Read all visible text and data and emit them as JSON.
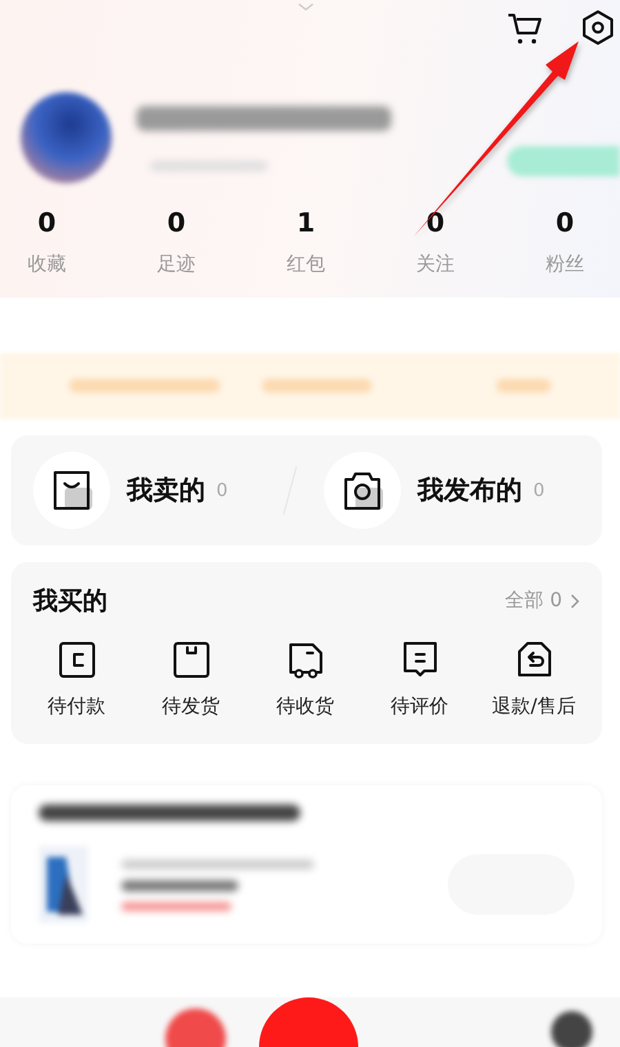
{
  "stats": [
    {
      "value": "0",
      "label": "收藏"
    },
    {
      "value": "0",
      "label": "足迹"
    },
    {
      "value": "1",
      "label": "红包"
    },
    {
      "value": "0",
      "label": "关注"
    },
    {
      "value": "0",
      "label": "粉丝"
    }
  ],
  "selling": [
    {
      "kind": "bag",
      "label": "我卖的",
      "count": "0"
    },
    {
      "kind": "camera",
      "label": "我发布的",
      "count": "0"
    }
  ],
  "purchases": {
    "title": "我买的",
    "all_link": "全部 0",
    "orders": [
      {
        "kind": "pay",
        "label": "待付款"
      },
      {
        "kind": "ship",
        "label": "待发货"
      },
      {
        "kind": "receive",
        "label": "待收货"
      },
      {
        "kind": "review",
        "label": "待评价"
      },
      {
        "kind": "refund",
        "label": "退款/售后"
      }
    ]
  }
}
